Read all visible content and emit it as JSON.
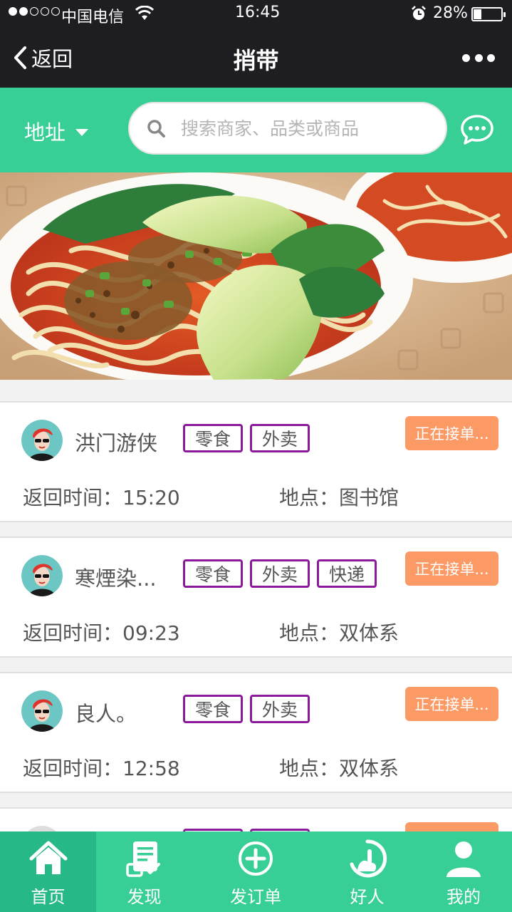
{
  "status_bar": {
    "carrier": "中国电信",
    "time": "16:45",
    "battery": "28%",
    "battery_level": 0.28
  },
  "nav": {
    "back_label": "返回",
    "title": "捎带"
  },
  "search_header": {
    "address_label": "地址",
    "search_placeholder": "搜索商家、品类或商品"
  },
  "orders": [
    {
      "name": "洪门游侠",
      "tags": [
        "零食",
        "外卖"
      ],
      "status": "正在接单...",
      "return_time": "返回时间：15:20",
      "location": "地点：图书馆"
    },
    {
      "name": "寒煙染...",
      "tags": [
        "零食",
        "外卖",
        "快递"
      ],
      "status": "正在接单...",
      "return_time": "返回时间：09:23",
      "location": "地点：双体系"
    },
    {
      "name": "良人。",
      "tags": [
        "零食",
        "外卖"
      ],
      "status": "正在接单...",
      "return_time": "返回时间：12:58",
      "location": "地点：双体系"
    }
  ],
  "tab_bar": {
    "tabs": [
      {
        "label": "首页",
        "icon": "home-icon",
        "active": true
      },
      {
        "label": "发现",
        "icon": "discover-icon",
        "active": false
      },
      {
        "label": "发订单",
        "icon": "add-order-icon",
        "active": false
      },
      {
        "label": "好人",
        "icon": "good-person-icon",
        "active": false
      },
      {
        "label": "我的",
        "icon": "profile-icon",
        "active": false
      }
    ]
  },
  "colors": {
    "header_green": "#38cf96",
    "tab_active_green": "#26b987",
    "status_orange": "#fb9a64",
    "tag_border_purple": "#8a1a9a",
    "dark_bar": "#1e1e22"
  }
}
